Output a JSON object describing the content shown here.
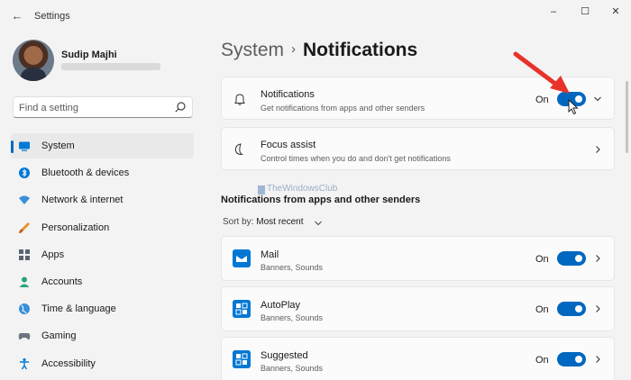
{
  "window": {
    "title": "Settings",
    "back_icon": "back-arrow-icon",
    "controls": {
      "minimize": "–",
      "maximize": "☐",
      "close": "✕"
    }
  },
  "profile": {
    "name": "Sudip Majhi"
  },
  "search": {
    "placeholder": "Find a setting",
    "icon": "search-icon"
  },
  "sidebar": {
    "accent": "#0067c0",
    "items": [
      {
        "label": "System",
        "icon": "system-icon",
        "active": true
      },
      {
        "label": "Bluetooth & devices",
        "icon": "bluetooth-icon"
      },
      {
        "label": "Network & internet",
        "icon": "network-icon"
      },
      {
        "label": "Personalization",
        "icon": "brush-icon"
      },
      {
        "label": "Apps",
        "icon": "apps-icon"
      },
      {
        "label": "Accounts",
        "icon": "accounts-icon"
      },
      {
        "label": "Time & language",
        "icon": "globe-icon"
      },
      {
        "label": "Gaming",
        "icon": "gamepad-icon"
      },
      {
        "label": "Accessibility",
        "icon": "accessibility-icon"
      }
    ]
  },
  "breadcrumb": {
    "parent": "System",
    "separator": "›",
    "current": "Notifications"
  },
  "cards": {
    "notifications": {
      "title": "Notifications",
      "subtitle": "Get notifications from apps and other senders",
      "state": "On",
      "icon": "bell-icon"
    },
    "focus": {
      "title": "Focus assist",
      "subtitle": "Control times when you do and don't get notifications",
      "icon": "moon-icon"
    }
  },
  "section": {
    "title": "Notifications from apps and other senders",
    "sort_label": "Sort by:",
    "sort_value": "Most recent"
  },
  "apps": [
    {
      "name": "Mail",
      "detail": "Banners, Sounds",
      "state": "On",
      "icon": "mail-icon"
    },
    {
      "name": "AutoPlay",
      "detail": "Banners, Sounds",
      "state": "On",
      "icon": "autoplay-icon"
    },
    {
      "name": "Suggested",
      "detail": "Banners, Sounds",
      "state": "On",
      "icon": "suggested-icon"
    }
  ],
  "watermark": "TheWindowsClub",
  "colors": {
    "toggle_on": "#0067c0",
    "annotation_arrow": "#e8322a",
    "background": "#f3f3f3",
    "card": "#fbfbfb"
  }
}
